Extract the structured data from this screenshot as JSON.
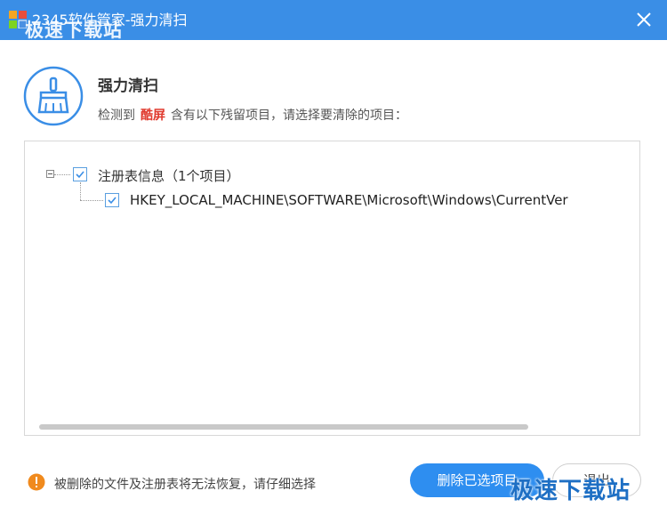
{
  "window": {
    "title": "2345软件管家-强力清扫",
    "close_icon": "close-icon",
    "titlebar_color": "#3a8ee6"
  },
  "watermark": {
    "top_text": "极速下载站",
    "corner_text": "极速下载站"
  },
  "header": {
    "icon": "broom-icon",
    "title": "强力清扫",
    "desc_before": "检测到",
    "software_name": "酷屏",
    "desc_after": "含有以下残留项目，请选择要清除的项目："
  },
  "tree": {
    "group_label": "注册表信息（1个项目）",
    "group_checked": true,
    "items": [
      {
        "label": "HKEY_LOCAL_MACHINE\\SOFTWARE\\Microsoft\\Windows\\CurrentVer",
        "checked": true
      }
    ]
  },
  "footer": {
    "warning_icon": "warning-icon",
    "warning_text": "被删除的文件及注册表将无法恢复，请仔细选择",
    "delete_button": "删除已选项目",
    "exit_button": "退出"
  },
  "colors": {
    "accent": "#2e8ef0",
    "highlight": "#e03a2e",
    "warning": "#f08a1d"
  }
}
